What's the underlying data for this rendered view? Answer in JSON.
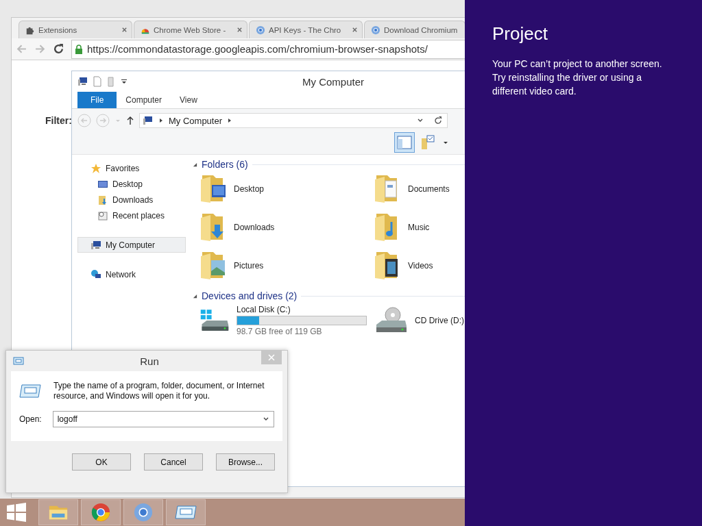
{
  "browser": {
    "tabs": [
      {
        "title": "Extensions",
        "kind": "extensions"
      },
      {
        "title": "Chrome Web Store -",
        "kind": "store"
      },
      {
        "title": "API Keys - The Chro",
        "kind": "chromium"
      },
      {
        "title": "Download Chromium",
        "kind": "chromium"
      }
    ],
    "url": "https://commondatastorage.googleapis.com/chromium-browser-snapshots/",
    "filter_label": "Filter:"
  },
  "explorer": {
    "title": "My Computer",
    "ribbon_tabs": [
      {
        "label": "File",
        "kind": "menu"
      },
      {
        "label": "Computer",
        "kind": "tab"
      },
      {
        "label": "View",
        "kind": "tab"
      }
    ],
    "address": "My Computer",
    "nav": [
      {
        "label": "Favorites",
        "kind": "favorites",
        "selected": false,
        "children": [
          {
            "label": "Desktop",
            "kind": "desktop",
            "selected": false
          },
          {
            "label": "Downloads",
            "kind": "downloads",
            "selected": false
          },
          {
            "label": "Recent places",
            "kind": "recent",
            "selected": false
          }
        ]
      },
      {
        "label": "My Computer",
        "kind": "computer",
        "selected": true
      },
      {
        "label": "Network",
        "kind": "network",
        "selected": false
      }
    ],
    "folders_header": "Folders (6)",
    "folders": [
      {
        "name": "Desktop",
        "kind": "desktop"
      },
      {
        "name": "Documents",
        "kind": "documents"
      },
      {
        "name": "Downloads",
        "kind": "downloads"
      },
      {
        "name": "Music",
        "kind": "music"
      },
      {
        "name": "Pictures",
        "kind": "pictures"
      },
      {
        "name": "Videos",
        "kind": "videos"
      }
    ],
    "drives_header": "Devices and drives (2)",
    "drives": [
      {
        "name": "Local Disk (C:)",
        "kind": "disk",
        "level": 0.17,
        "free": "98.7 GB free of 119 GB"
      },
      {
        "name": "CD Drive (D:)",
        "kind": "cd"
      }
    ]
  },
  "run": {
    "title": "Run",
    "message": "Type the name of a program, folder, document, or Internet resource, and Windows will open it for you.",
    "open_label": "Open:",
    "value": "logoff",
    "buttons": [
      "OK",
      "Cancel",
      "Browse..."
    ]
  },
  "taskbar": {
    "apps": [
      {
        "kind": "explorer"
      },
      {
        "kind": "chrome"
      },
      {
        "kind": "chromium"
      },
      {
        "kind": "run"
      }
    ]
  },
  "project": {
    "title": "Project",
    "message": "Your PC can’t project to another screen. Try reinstalling the driver or using a different video card."
  }
}
